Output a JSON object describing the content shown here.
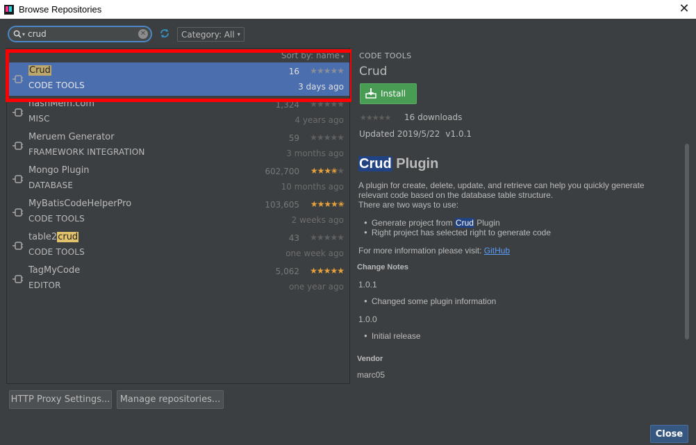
{
  "window": {
    "title": "Browse Repositories",
    "close_glyph": "✕"
  },
  "toolbar": {
    "search_value": "crud",
    "search_icon": "search-icon",
    "clear_glyph": "✕",
    "category_label": "Category: All",
    "dropdown_glyph": "▾"
  },
  "list": {
    "sort_label": "Sort by: name",
    "sort_glyph": "▾",
    "items": [
      {
        "name_prefix": "",
        "name_match": "Crud",
        "name_suffix": "",
        "category": "CODE TOOLS",
        "downloads": "16",
        "stars": 0,
        "updated": "3 days ago"
      },
      {
        "name_prefix": "hashMem.com",
        "name_match": "",
        "name_suffix": "",
        "category": "MISC",
        "downloads": "1,324",
        "stars": 0,
        "updated": "4 years ago"
      },
      {
        "name_prefix": "Meruem Generator",
        "name_match": "",
        "name_suffix": "",
        "category": "FRAMEWORK INTEGRATION",
        "downloads": "59",
        "stars": 0,
        "updated": "3 months ago"
      },
      {
        "name_prefix": "Mongo Plugin",
        "name_match": "",
        "name_suffix": "",
        "category": "DATABASE",
        "downloads": "602,700",
        "stars": 3.5,
        "updated": "10 months ago"
      },
      {
        "name_prefix": "MyBatisCodeHelperPro",
        "name_match": "",
        "name_suffix": "",
        "category": "CODE TOOLS",
        "downloads": "103,605",
        "stars": 4.5,
        "updated": "2 weeks ago"
      },
      {
        "name_prefix": "table2",
        "name_match": "crud",
        "name_suffix": "",
        "category": "CODE TOOLS",
        "downloads": "43",
        "stars": 0,
        "updated": "one week ago"
      },
      {
        "name_prefix": "TagMyCode",
        "name_match": "",
        "name_suffix": "",
        "category": "EDITOR",
        "downloads": "5,062",
        "stars": 5,
        "updated": "one year ago"
      }
    ]
  },
  "detail": {
    "category": "CODE TOOLS",
    "name": "Crud",
    "install_label": "Install",
    "downloads_text": "16 downloads",
    "updated_text": "Updated 2019/5/22",
    "version": "v1.0.1",
    "heading_match": "Crud",
    "heading_rest": " Plugin",
    "desc1": "A plugin for create, delete, update, and retrieve can help you quickly generate relevant code based on the database table structure.",
    "desc2": "There are two ways to use:",
    "bullet1_prefix": "Generate project from ",
    "bullet1_match": "Crud",
    "bullet1_suffix": " Plugin",
    "bullet2": "Right project has selected right to generate code",
    "more_prefix": "For more information please visit: ",
    "more_link": "GitHub",
    "change_notes_title": "Change Notes",
    "v1": "1.0.1",
    "v1_note": "Changed some plugin information",
    "v2": "1.0.0",
    "v2_note": "Initial release",
    "vendor_title": "Vendor",
    "vendor_name": "marc05"
  },
  "buttons": {
    "proxy": "HTTP Proxy Settings...",
    "manage": "Manage repositories...",
    "close": "Close"
  },
  "colors": {
    "accent": "#4b6eaf",
    "install_green": "#499c54",
    "star_on": "#e8a23a",
    "highlight_box": "#ff0000"
  }
}
